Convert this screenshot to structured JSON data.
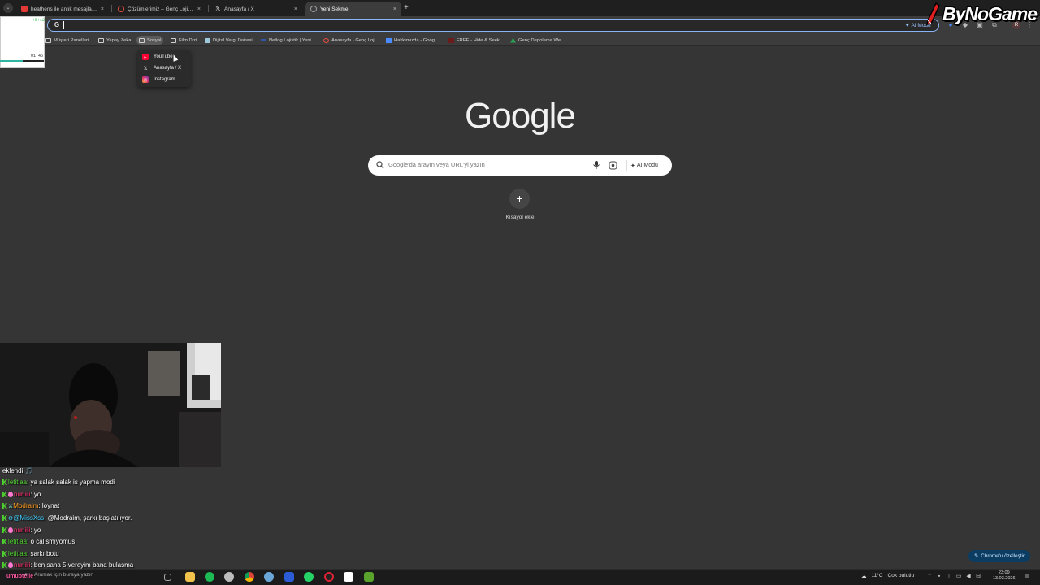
{
  "tabs": [
    {
      "title": "heathens ile anlık mesajlaşma",
      "favicon_color": "#e53935"
    },
    {
      "title": "Çözümlerimiz – Genç Lojistik",
      "favicon_color": "#e74c3c"
    },
    {
      "title": "Anasayfa / X",
      "favicon_color": "#ffffff"
    },
    {
      "title": "Yeni Sekme",
      "favicon_color": "#9aa0a6",
      "active": true
    }
  ],
  "tab_close": "×",
  "new_tab": "+",
  "omnibox": {
    "value": "",
    "ai_label": "AI Modu"
  },
  "bookmarks": [
    "Müşteri Panelleri",
    "Yapay Zeka",
    "Sosyal",
    "Film Dizi",
    "Dijital Vergi Dairesi",
    "Netlog Lojistik | Yeni...",
    "Anasayfa - Genç Loj...",
    "Hakkımızda - Googl...",
    "FREE - Hide & Seek...",
    "Genç Depolama We..."
  ],
  "sosyal_menu": [
    "YouTube",
    "Anasayfa / X",
    "Instagram"
  ],
  "overlay": {
    "top_value": "+5+12",
    "time": "01:46"
  },
  "brand": "ByNoGame",
  "google_logo": "Google",
  "search": {
    "placeholder": "Google'da arayın veya URL'yi yazın",
    "ai_label": "AI Modu"
  },
  "shortcut": {
    "plus": "+",
    "label": "Kısayol ekle"
  },
  "chat": [
    {
      "user": "",
      "user_color": "#ffffff",
      "text": "eklendi 🎵"
    },
    {
      "user": "letitiaa",
      "user_color": "#4fd32f",
      "text": ": ya salak salak is yapma modi"
    },
    {
      "user": "nuriiiii",
      "user_color": "#ff2a6d",
      "text": ": yo"
    },
    {
      "user": "Modraim",
      "user_color": "#ff9a1f",
      "text": ": loynat"
    },
    {
      "user": "@MissXss",
      "user_color": "#41d0ff",
      "text": ": @Modraim, şarkı başlatılıyor."
    },
    {
      "user": "nuriiiii",
      "user_color": "#ff2a6d",
      "text": ": yo"
    },
    {
      "user": "letitiaa",
      "user_color": "#4fd32f",
      "text": ": o calismiyomus"
    },
    {
      "user": "letitiaa",
      "user_color": "#4fd32f",
      "text": ": sarkı botu"
    },
    {
      "user": "nuriiiii",
      "user_color": "#ff2a6d",
      "text": ": ben sana 5 vereyim bana bulasma"
    }
  ],
  "customize_chrome": "Chrome'u özelleştir",
  "taskbar": {
    "search_placeholder": "Aramak için buraya yazın",
    "overlay_name": "umupteile",
    "weather": "11°C",
    "weather_desc": "Çok bulutlu",
    "time": "23:09",
    "date": "13.03.2026"
  }
}
